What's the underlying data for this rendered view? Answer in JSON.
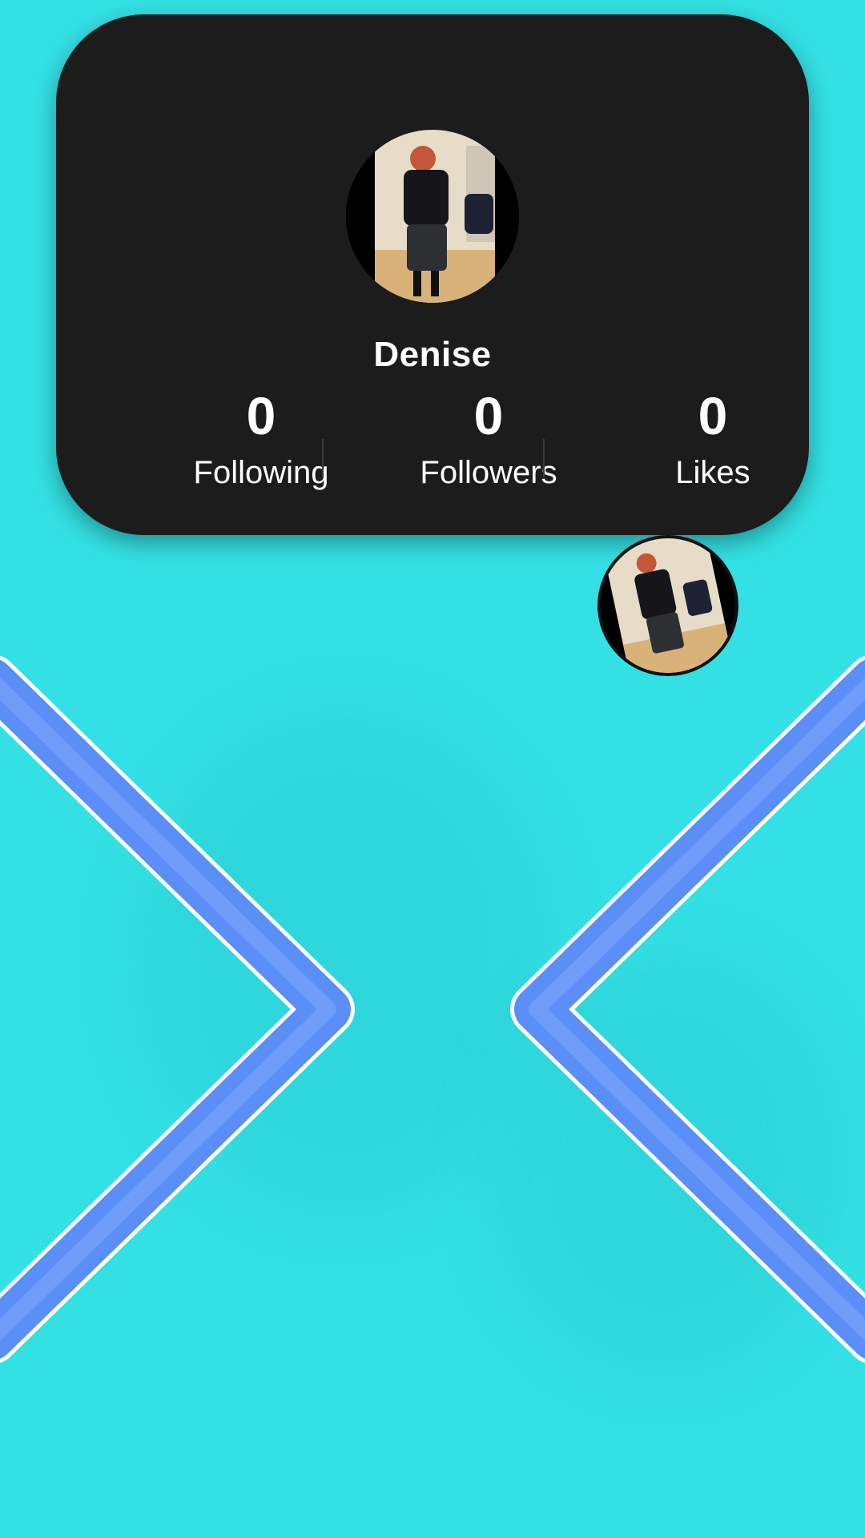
{
  "profile": {
    "username": "Denise",
    "avatar_icon": "profile-photo",
    "stats": [
      {
        "value": "0",
        "label": "Following"
      },
      {
        "value": "0",
        "label": "Followers"
      },
      {
        "value": "0",
        "label": "Likes"
      }
    ]
  },
  "floating_avatar": {
    "icon": "profile-photo"
  },
  "navigation": {
    "left_icon": "chevron-left",
    "right_icon": "chevron-right",
    "color": "#5b8ef7",
    "outline_color": "#ffffff"
  },
  "colors": {
    "background": "#33e0e3",
    "card": "#1c1c1c",
    "text": "#ffffff"
  }
}
